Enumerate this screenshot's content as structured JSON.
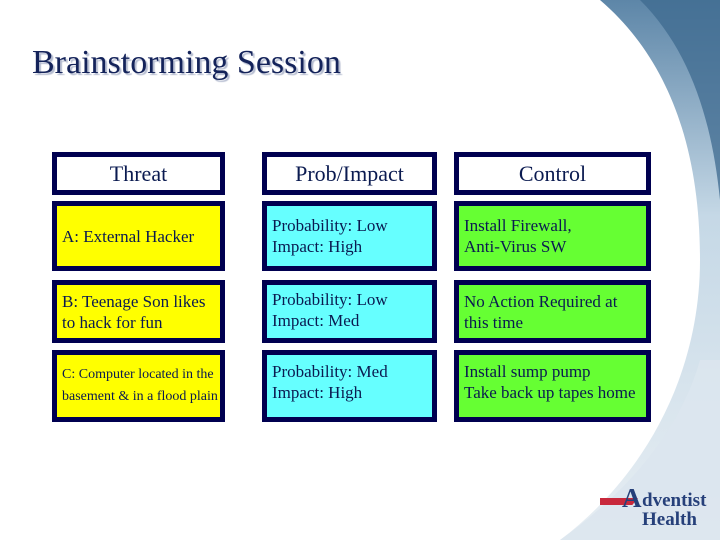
{
  "slide": {
    "title": "Brainstorming Session"
  },
  "table": {
    "headers": [
      "Threat",
      "Prob/Impact",
      "Control"
    ],
    "rows": [
      {
        "threat": "A: External Hacker",
        "prob_line1": "Probability: Low",
        "prob_line2": "Impact: High",
        "control_line1": "Install Firewall,",
        "control_line2": "Anti-Virus SW"
      },
      {
        "threat_line1": "B: Teenage Son likes",
        "threat_line2": "to hack for fun",
        "prob_line1": "Probability: Low",
        "prob_line2": "Impact: Med",
        "control_line1": "No Action Required at",
        "control_line2": "this time"
      },
      {
        "threat_line1": "C: Computer located in the",
        "threat_line2": "basement & in a flood plain",
        "prob_line1": "Probability: Med",
        "prob_line2": "Impact: High",
        "control_line1": "Install sump pump",
        "control_line2": "Take back up tapes home"
      }
    ],
    "colors": {
      "border": "#000050",
      "threat_fill": "#ffff00",
      "prob_fill": "#66ffff",
      "control_fill": "#66ff33"
    }
  },
  "logo": {
    "line1_initial": "A",
    "line1_rest": "dventist",
    "line2": "Health"
  }
}
